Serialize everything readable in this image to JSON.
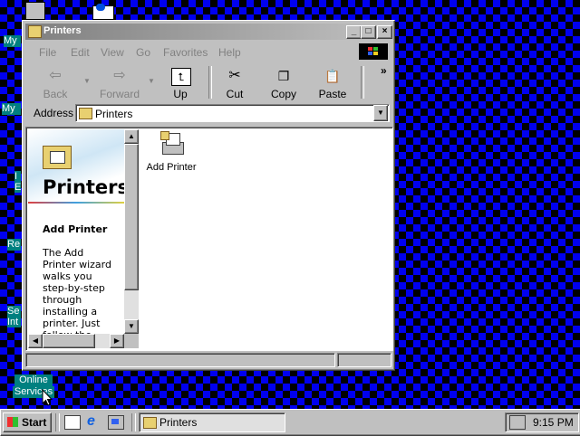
{
  "desktop": {
    "icons": [
      {
        "label": "My"
      },
      {
        "label": "My"
      },
      {
        "label": "I"
      },
      {
        "label": "E"
      },
      {
        "label": "Re"
      },
      {
        "label": "Se"
      },
      {
        "label": "Int"
      },
      {
        "label": "Online"
      },
      {
        "label": "Services"
      }
    ]
  },
  "window": {
    "title": "Printers",
    "controls": {
      "minimize": "_",
      "maximize": "□",
      "close": "×"
    },
    "menu": [
      "File",
      "Edit",
      "View",
      "Go",
      "Favorites",
      "Help"
    ],
    "toolbar": {
      "back": "Back",
      "forward": "Forward",
      "up": "Up",
      "cut": "Cut",
      "copy": "Copy",
      "paste": "Paste",
      "more": "»"
    },
    "address": {
      "label": "Address",
      "value": "Printers"
    },
    "left_pane": {
      "heading": "Printers",
      "subheading": "Add Printer",
      "description": "The Add Printer wizard walks you step-by-step through installing a printer. Just follow the"
    },
    "items": [
      {
        "label": "Add Printer",
        "icon": "add-printer-icon"
      }
    ]
  },
  "taskbar": {
    "start_label": "Start",
    "quicklaunch": [
      "show-desktop-icon",
      "internet-explorer-icon",
      "channels-icon"
    ],
    "tasks": [
      {
        "label": "Printers"
      }
    ],
    "clock": "9:15 PM"
  }
}
